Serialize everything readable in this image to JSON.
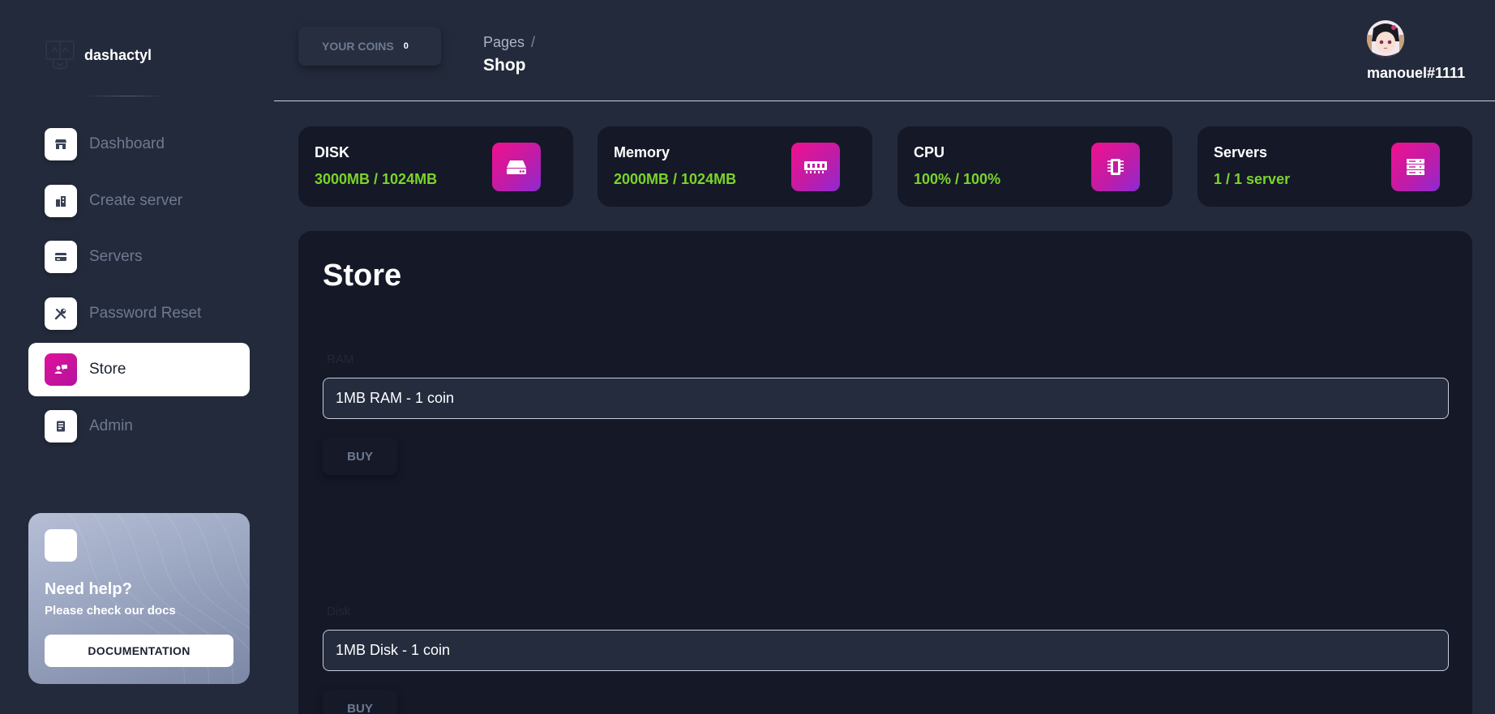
{
  "brand": {
    "name": "dashactyl"
  },
  "sidebar": {
    "items": [
      {
        "label": "Dashboard",
        "icon": "shop-icon"
      },
      {
        "label": "Create server",
        "icon": "building-icon"
      },
      {
        "label": "Servers",
        "icon": "credit-card-icon"
      },
      {
        "label": "Password Reset",
        "icon": "tools-icon"
      },
      {
        "label": "Store",
        "icon": "user-chat-icon",
        "active": true
      },
      {
        "label": "Admin",
        "icon": "document-icon"
      }
    ],
    "help": {
      "title": "Need help?",
      "subtitle": "Please check our docs",
      "button": "DOCUMENTATION"
    }
  },
  "header": {
    "coins_label": "YOUR COINS",
    "coins_value": "0",
    "breadcrumb_parent": "Pages",
    "breadcrumb_separator": "/",
    "breadcrumb_current": "Shop",
    "username": "manouel#1111"
  },
  "stats": [
    {
      "title": "DISK",
      "value": "3000MB / 1024MB",
      "icon": "hard-drive-icon"
    },
    {
      "title": "Memory",
      "value": "2000MB / 1024MB",
      "icon": "memory-icon"
    },
    {
      "title": "CPU",
      "value": "100% / 100%",
      "icon": "cpu-icon"
    },
    {
      "title": "Servers",
      "value": "1 / 1 server",
      "icon": "server-icon"
    }
  ],
  "store": {
    "title": "Store",
    "items": [
      {
        "label": "RAM",
        "selected": "1MB RAM - 1 coin",
        "button": "BUY"
      },
      {
        "label": "Disk",
        "selected": "1MB Disk - 1 coin",
        "button": "BUY"
      }
    ]
  },
  "colors": {
    "accent_pink": "#e0119a",
    "value_green": "#7ad42a",
    "background": "#232a3b",
    "card": "#151827"
  }
}
